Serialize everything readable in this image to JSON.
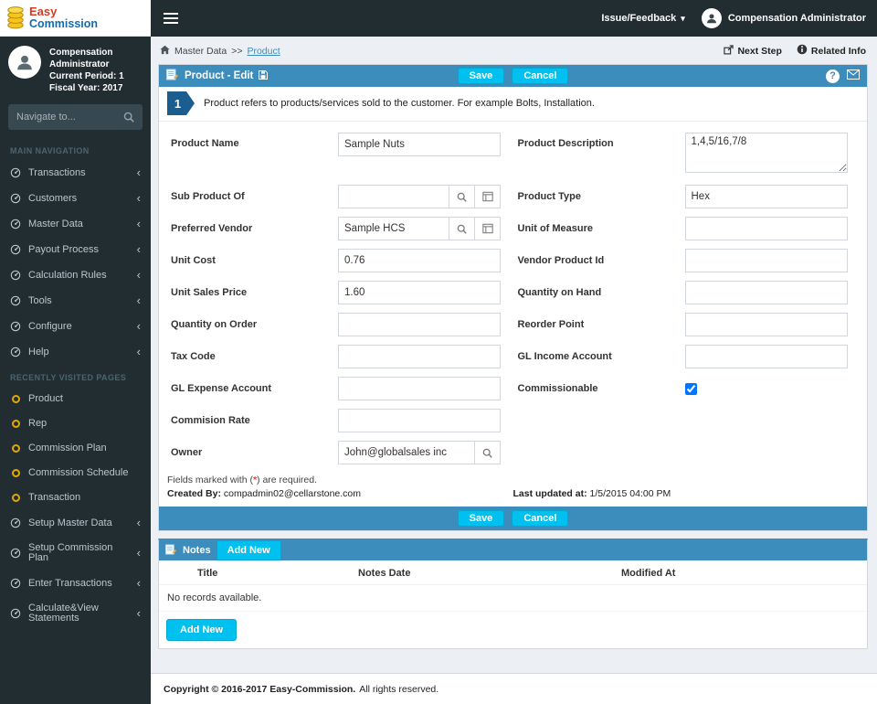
{
  "colors": {
    "accent": "#3c8dbc",
    "info_button": "#00c0ef",
    "sidebar_bg": "#222d32",
    "required": "#dd4b39",
    "badge": "#1c5d8f"
  },
  "brand": {
    "easy": "Easy",
    "commission": "Commission"
  },
  "topbar": {
    "feedback_label": "Issue/Feedback",
    "user_name": "Compensation Administrator"
  },
  "sidebar": {
    "user_name": "Compensation Administrator",
    "user_period": "Current Period: 1",
    "user_fiscal": "Fiscal Year: 2017",
    "search_placeholder": "Navigate to...",
    "main_nav_label": "MAIN NAVIGATION",
    "recent_label": "RECENTLY VISITED PAGES",
    "nav_items": [
      "Transactions",
      "Customers",
      "Master Data",
      "Payout Process",
      "Calculation Rules",
      "Tools",
      "Configure",
      "Help"
    ],
    "recent_items": [
      "Product",
      "Rep",
      "Commission Plan",
      "Commission Schedule",
      "Transaction"
    ],
    "bottom_items": [
      "Setup Master Data",
      "Setup Commission Plan",
      "Enter Transactions",
      "Calculate&View Statements"
    ]
  },
  "breadcrumb": {
    "section": "Master Data",
    "separator": ">>",
    "current": "Product",
    "next_step": "Next Step",
    "related_info": "Related Info"
  },
  "edit_header": {
    "title": "Product - Edit"
  },
  "buttons": {
    "save": "Save",
    "cancel": "Cancel",
    "add_new": "Add New"
  },
  "info_note": {
    "number": "1",
    "text": "Product refers to products/services sold to the customer. For example Bolts, Installation."
  },
  "form": {
    "left": [
      {
        "label": "Product Name",
        "value": "Sample Nuts"
      },
      {
        "label": "Sub Product Of",
        "value": "",
        "buttons": [
          "search",
          "list"
        ]
      },
      {
        "label": "Preferred Vendor",
        "value": "Sample HCS",
        "buttons": [
          "search",
          "list"
        ]
      },
      {
        "label": "Unit Cost",
        "value": "0.76"
      },
      {
        "label": "Unit Sales Price",
        "value": "1.60"
      },
      {
        "label": "Quantity on Order",
        "value": ""
      },
      {
        "label": "Tax Code",
        "value": ""
      },
      {
        "label": "GL Expense Account",
        "value": ""
      },
      {
        "label": "Commision Rate",
        "value": ""
      },
      {
        "label": "Owner",
        "value": "John@globalsales inc",
        "buttons": [
          "search"
        ]
      }
    ],
    "right": [
      {
        "label": "Product Description",
        "value": "1,4,5/16,7/8",
        "type": "textarea"
      },
      {
        "label": "Product Type",
        "value": "Hex"
      },
      {
        "label": "Unit of Measure",
        "value": ""
      },
      {
        "label": "Vendor Product Id",
        "value": ""
      },
      {
        "label": "Quantity on Hand",
        "value": ""
      },
      {
        "label": "Reorder Point",
        "value": ""
      },
      {
        "label": "GL Income Account",
        "value": ""
      },
      {
        "label": "Commissionable",
        "type": "checkbox",
        "checked": true
      }
    ]
  },
  "meta": {
    "required_pre": "Fields marked with (",
    "required_star": "*",
    "required_post": ") are required.",
    "created_label": "Created By:",
    "created_value": "compadmin02@cellarstone.com",
    "updated_label": "Last updated at:",
    "updated_value": "1/5/2015 04:00 PM"
  },
  "notes": {
    "title": "Notes",
    "columns": [
      "Title",
      "Notes Date",
      "Modified At"
    ],
    "empty": "No records available."
  },
  "footer": {
    "bold": "Copyright © 2016-2017 Easy-Commission.",
    "normal": "All rights reserved."
  }
}
